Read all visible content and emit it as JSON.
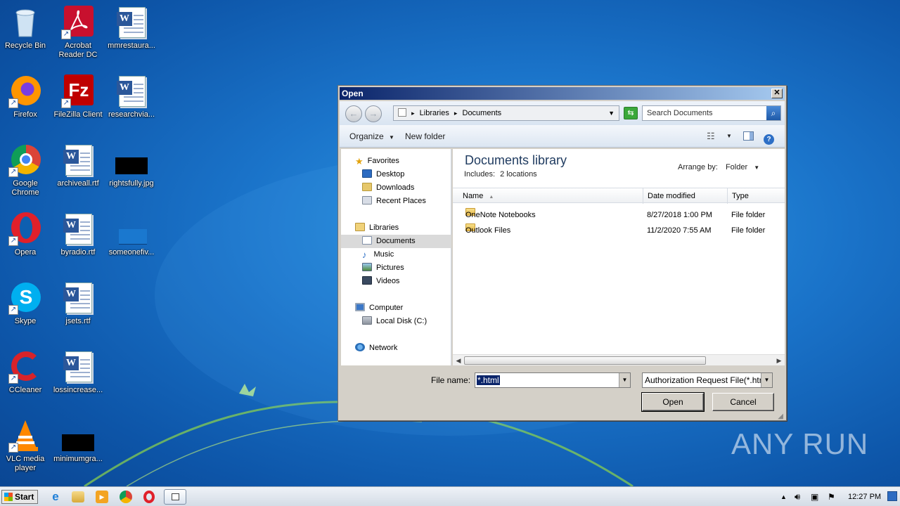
{
  "desktop": {
    "icons": [
      {
        "label": "Recycle Bin"
      },
      {
        "label": "Acrobat Reader DC"
      },
      {
        "label": "mmrestaura..."
      },
      {
        "label": "Firefox"
      },
      {
        "label": "FileZilla Client"
      },
      {
        "label": "researchvia..."
      },
      {
        "label": "Google Chrome"
      },
      {
        "label": "archiveall.rtf"
      },
      {
        "label": "rightsfully.jpg"
      },
      {
        "label": "Opera"
      },
      {
        "label": "byradio.rtf"
      },
      {
        "label": "someonefiv..."
      },
      {
        "label": "Skype"
      },
      {
        "label": "jsets.rtf"
      },
      {
        "label": "CCleaner"
      },
      {
        "label": "lossincrease..."
      },
      {
        "label": "VLC media player"
      },
      {
        "label": "minimumgra..."
      }
    ],
    "watermark": "ANY RUN"
  },
  "dialog": {
    "title": "Open",
    "close_glyph": "✕",
    "address": {
      "root_glyph": "▸",
      "crumb1": "Libraries",
      "sep": "▸",
      "crumb2": "Documents"
    },
    "search_placeholder": "Search Documents",
    "toolbar": {
      "organize": "Organize",
      "new_folder": "New folder"
    },
    "nav": {
      "favorites": "Favorites",
      "desktop": "Desktop",
      "downloads": "Downloads",
      "recent": "Recent Places",
      "libraries": "Libraries",
      "documents": "Documents",
      "music": "Music",
      "pictures": "Pictures",
      "videos": "Videos",
      "computer": "Computer",
      "local_disk": "Local Disk (C:)",
      "network": "Network"
    },
    "library": {
      "title": "Documents library",
      "includes_label": "Includes:",
      "includes_value": "2 locations",
      "arrange_label": "Arrange by:",
      "arrange_value": "Folder"
    },
    "columns": {
      "name": "Name",
      "date": "Date modified",
      "type": "Type"
    },
    "files": [
      {
        "name": "OneNote Notebooks",
        "date": "8/27/2018 1:00 PM",
        "type": "File folder"
      },
      {
        "name": "Outlook Files",
        "date": "11/2/2020 7:55 AM",
        "type": "File folder"
      }
    ],
    "filename_label": "File name:",
    "filename_value": "*.html",
    "filetype_value": "Authorization Request File(*.htr",
    "open_button": "Open",
    "cancel_button": "Cancel"
  },
  "taskbar": {
    "start_label": "Start",
    "clock": "12:27 PM"
  }
}
